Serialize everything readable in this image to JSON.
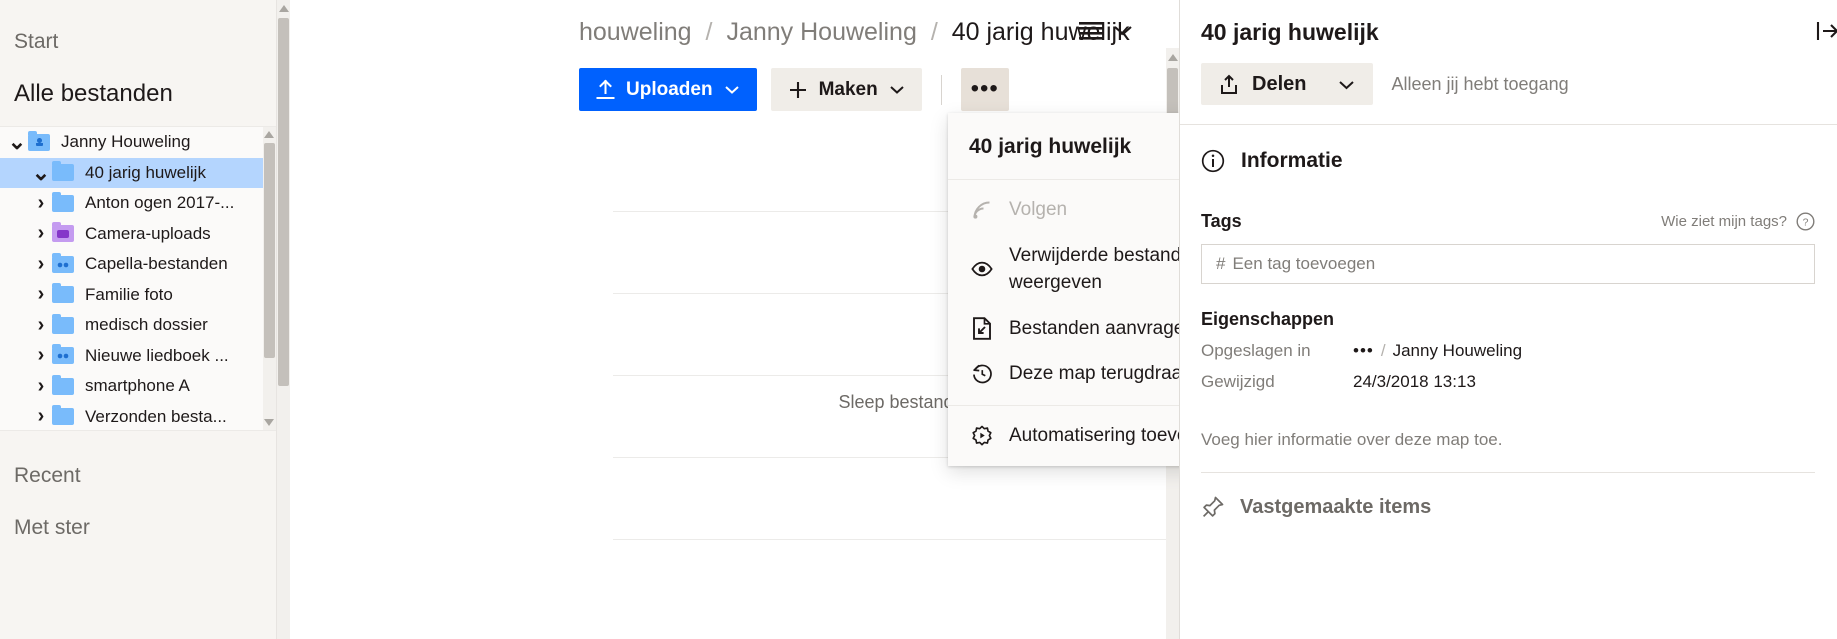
{
  "sidebar": {
    "start_label": "Start",
    "all_files_label": "Alle bestanden",
    "tree": [
      {
        "label": "Janny Houweling",
        "depth": 0,
        "caret": "down",
        "icon": "folder-person-icon",
        "selected": false
      },
      {
        "label": "40 jarig huwelijk",
        "depth": 1,
        "caret": "down",
        "icon": "folder-icon",
        "selected": true
      },
      {
        "label": "Anton ogen 2017-...",
        "depth": 1,
        "caret": "right",
        "icon": "folder-icon",
        "selected": false
      },
      {
        "label": "Camera-uploads",
        "depth": 1,
        "caret": "right",
        "icon": "folder-camera-icon",
        "selected": false
      },
      {
        "label": "Capella-bestanden",
        "depth": 1,
        "caret": "right",
        "icon": "folder-shared-icon",
        "selected": false
      },
      {
        "label": "Familie foto",
        "depth": 1,
        "caret": "right",
        "icon": "folder-icon",
        "selected": false
      },
      {
        "label": "medisch dossier",
        "depth": 1,
        "caret": "right",
        "icon": "folder-icon",
        "selected": false
      },
      {
        "label": "Nieuwe liedboek ...",
        "depth": 1,
        "caret": "right",
        "icon": "folder-shared-icon",
        "selected": false
      },
      {
        "label": "smartphone A",
        "depth": 1,
        "caret": "right",
        "icon": "folder-icon",
        "selected": false
      },
      {
        "label": "Verzonden besta...",
        "depth": 1,
        "caret": "right",
        "icon": "folder-icon",
        "selected": false
      }
    ],
    "recent_label": "Recent",
    "starred_label": "Met ster"
  },
  "breadcrumb": {
    "part1": "houweling",
    "part2": "Janny Houweling",
    "current": "40 jarig huwelijk",
    "separator": "/"
  },
  "toolbar": {
    "upload_label": "Uploaden",
    "create_label": "Maken",
    "more_label": "•••"
  },
  "main": {
    "drag_hint": "Sleep bestand"
  },
  "menu": {
    "header": "40 jarig huwelijk",
    "groups": [
      {
        "items": [
          {
            "label": "Volgen",
            "icon": "rss-follow-icon",
            "disabled": true
          },
          {
            "label": "Verwijderde bestanden weergeven",
            "icon": "eye-icon",
            "disabled": false
          },
          {
            "label": "Bestanden aanvragen",
            "icon": "file-request-icon",
            "disabled": false
          },
          {
            "label": "Deze map terugdraaien",
            "icon": "history-rewind-icon",
            "disabled": false
          }
        ]
      },
      {
        "items": [
          {
            "label": "Automatisering toevoegen",
            "icon": "gear-automation-icon",
            "disabled": false
          }
        ]
      }
    ]
  },
  "right_panel": {
    "title": "40 jarig huwelijk",
    "share_label": "Delen",
    "access_text": "Alleen jij hebt toegang",
    "info_label": "Informatie",
    "tags_label": "Tags",
    "who_sees_tags": "Wie ziet mijn tags?",
    "tag_placeholder": "Een tag toevoegen",
    "tag_hash": "#",
    "properties_label": "Eigenschappen",
    "properties": [
      {
        "key": "Opgeslagen in",
        "dots": "•••",
        "slash": "/",
        "value": "Janny Houweling"
      },
      {
        "key": "Gewijzigd",
        "dots": "",
        "slash": "",
        "value": "24/3/2018 13:13"
      }
    ],
    "note": "Voeg hier informatie over deze map toe.",
    "pinned_label": "Vastgemaakte items"
  },
  "colors": {
    "accent": "#0061fe",
    "selection": "#b4d5fe",
    "sidebar_bg": "#f7f5f2",
    "button_secondary": "#f0ede8"
  }
}
